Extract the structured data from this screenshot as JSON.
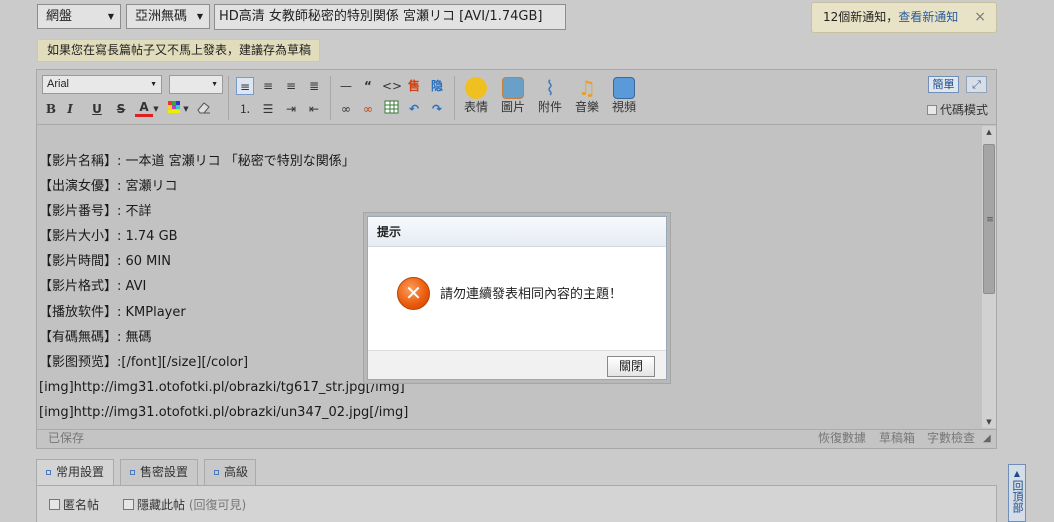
{
  "header": {
    "category1": "網盤",
    "category2": "亞洲無碼",
    "title_value": "HD高清 女教師秘密的特別関係 宮瀬リコ [AVI/1.74GB]",
    "notice_count_text": "12個新通知，",
    "notice_link": "查看新通知",
    "notice_close": "×",
    "draft_tip": "如果您在寫長篇帖子又不馬上發表，建議存為草稿"
  },
  "toolbar": {
    "font_name": "Arial",
    "font_size": "",
    "simplified": "簡單",
    "fullscreen": "⤢",
    "code_mode": "代碼模式",
    "big_buttons": [
      {
        "label": "表情",
        "icon": "smiley-icon",
        "color": "#f0c020"
      },
      {
        "label": "圖片",
        "icon": "image-icon",
        "color": "#6aa0c8"
      },
      {
        "label": "附件",
        "icon": "paperclip-icon",
        "color": "#4a7ab8"
      },
      {
        "label": "音樂",
        "icon": "music-icon",
        "color": "#e8a020"
      },
      {
        "label": "視頻",
        "icon": "video-icon",
        "color": "#5a9ad8"
      }
    ]
  },
  "content": {
    "lines": [
      "【影片名稱】: 一本道 宮瀬リコ 「秘密で特別な関係」",
      "【出演女優】: 宮瀬リコ",
      "【影片番号】: 不詳",
      "【影片大小】: 1.74 GB",
      "【影片時間】: 60 MIN",
      "【影片格式】: AVI",
      "【播放软件】: KMPlayer",
      "【有碼無碼】: 無碼",
      "【影图预览】:[/font][/size][/color]",
      "[img]http://img31.otofotki.pl/obrazki/tg617_str.jpg[/img]",
      "[img]http://img31.otofotki.pl/obrazki/un347_02.jpg[/img]"
    ]
  },
  "statusbar": {
    "saved": "已保存",
    "restore": "恢復數據",
    "drafts": "草稿箱",
    "wordcount": "字數檢查"
  },
  "tabs": [
    "常用設置",
    "售密設置",
    "高級"
  ],
  "options": {
    "anonymous": "匿名帖",
    "hide_post": "隱藏此帖",
    "hide_note": "(回復可見)"
  },
  "backtop": "回頂部",
  "dialog": {
    "title": "提示",
    "message": "請勿連續發表相同內容的主題！",
    "close": "關閉",
    "icon": "error-icon"
  }
}
